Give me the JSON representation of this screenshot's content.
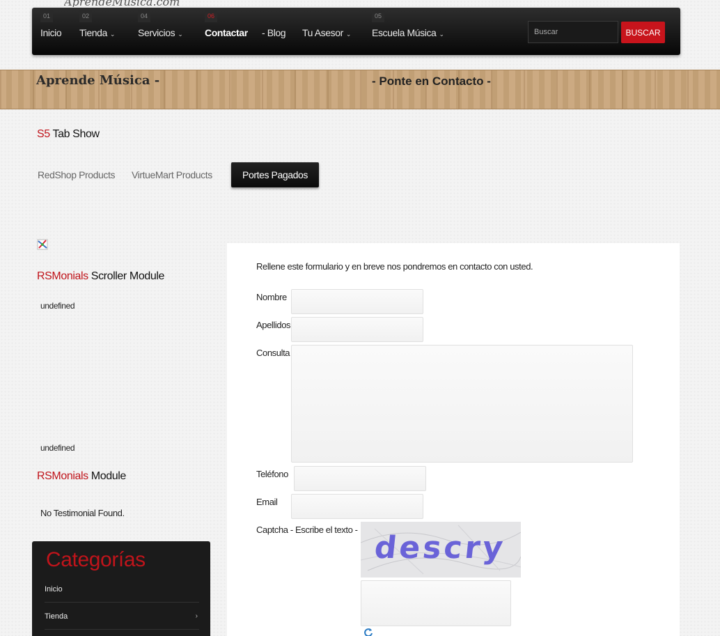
{
  "header": {
    "logo_text": "AprendeMusica.com",
    "nav": [
      {
        "num": "01",
        "label": "Inicio",
        "chevron": false,
        "active": false
      },
      {
        "num": "02",
        "label": "Tienda",
        "chevron": true,
        "active": false
      },
      {
        "num": "04",
        "label": "Servicios",
        "chevron": true,
        "active": false
      },
      {
        "num": "06",
        "label": "Contactar",
        "chevron": false,
        "active": true
      },
      {
        "num": "",
        "label": "- Blog",
        "chevron": false,
        "active": false
      },
      {
        "num": "",
        "label": "Tu Asesor",
        "chevron": true,
        "active": false
      },
      {
        "num": "05",
        "label": "Escuela Música",
        "chevron": true,
        "active": false
      }
    ],
    "search_placeholder": "Buscar",
    "search_button": "BUSCAR"
  },
  "banner": {
    "title": "Aprende Música -",
    "subtitle": "- Ponte en Contacto -"
  },
  "tabshow": {
    "title_prefix": "S5",
    "title_rest": " Tab Show",
    "tabs": [
      "RedShop Products",
      "VirtueMart Products",
      "Portes Pagados"
    ],
    "active_tab": 2
  },
  "sidebar": {
    "scroller_title_prefix": "RSMonials",
    "scroller_title_rest": " Scroller Module",
    "scroller_top_text": "undefined",
    "scroller_bottom_text": "undefined",
    "module_title_prefix": "RSMonials",
    "module_title_rest": " Module",
    "no_testimonial": "No Testimonial Found.",
    "categories_title": "Categorías",
    "categories": [
      {
        "label": "Inicio",
        "chevron": false
      },
      {
        "label": "Tienda",
        "chevron": true
      }
    ]
  },
  "form": {
    "intro": "Rellene este formulario y en breve nos pondremos en contacto con usted.",
    "labels": {
      "nombre": "Nombre",
      "apellidos": "Apellidos",
      "consulta": "Consulta",
      "telefono": "Teléfono",
      "email": "Email",
      "captcha": "Captcha - Escribe el texto -"
    },
    "captcha_text": "descry"
  },
  "colors": {
    "accent_red": "#c0141b",
    "nav_bg": "#0a0a0a",
    "search_button_bg": "#c8141c"
  }
}
